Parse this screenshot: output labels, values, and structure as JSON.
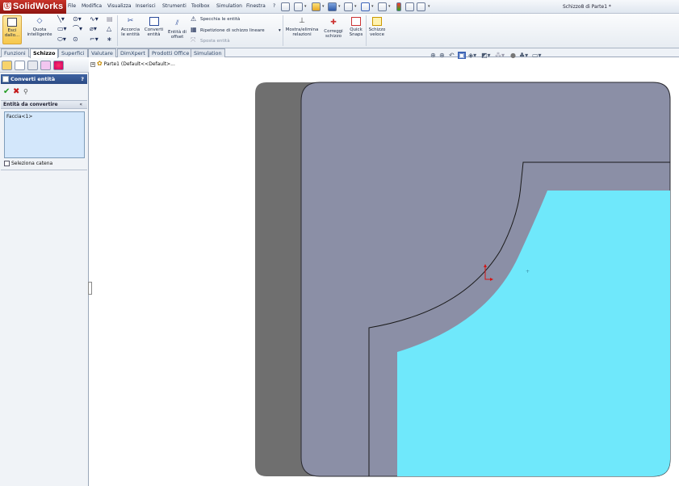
{
  "app": {
    "name": "SolidWorks",
    "document_title": "Schizzo8 di Parte1 *"
  },
  "menu": [
    "File",
    "Modifica",
    "Visualizza",
    "Inserisci",
    "Strumenti",
    "Toolbox",
    "Simulation",
    "Finestra",
    "?"
  ],
  "ribbon": {
    "exit_sketch": {
      "line1": "Esci",
      "line2": "dallo..."
    },
    "smart_dim": {
      "line1": "Quota",
      "line2": "intelligente"
    },
    "trim": {
      "line1": "Accorcia",
      "line2": "le entità"
    },
    "convert": {
      "line1": "Converti",
      "line2": "entità"
    },
    "offset": {
      "line1": "Entità di",
      "line2": "offset"
    },
    "mirror": "Specchia le entità",
    "linear_pattern": "Ripetizione di schizzo lineare",
    "move": "Sposta entità",
    "relations": {
      "line1": "Mostra/elimina",
      "line2": "relazioni"
    },
    "repair": {
      "line1": "Correggi",
      "line2": "schizzo"
    },
    "snaps": {
      "line1": "Quick",
      "line2": "Snaps"
    },
    "rapid": {
      "line1": "Schizzo",
      "line2": "veloce"
    }
  },
  "command_tabs": [
    "Funzioni",
    "Schizzo",
    "Superfici",
    "Valutare",
    "DimXpert",
    "Prodotti Office",
    "Simulation"
  ],
  "active_tab": "Schizzo",
  "property_manager": {
    "title": "Converti entità",
    "help": "?",
    "ok_icon": "✔",
    "cancel_icon": "✖",
    "pin_icon": "⚲",
    "group_title": "Entità da convertire",
    "group_chevron": "«",
    "selection": "Faccia<1>",
    "chain_label": "Seleziona catena",
    "chain_checked": false
  },
  "feature_tree": {
    "root": "Parte1  (Default<<Default>..."
  },
  "colors": {
    "part_face": "#8b8fa6",
    "selected_face": "#6fe8fb",
    "shadow": "#6f6f6f",
    "title_blue": "#2f5293"
  }
}
